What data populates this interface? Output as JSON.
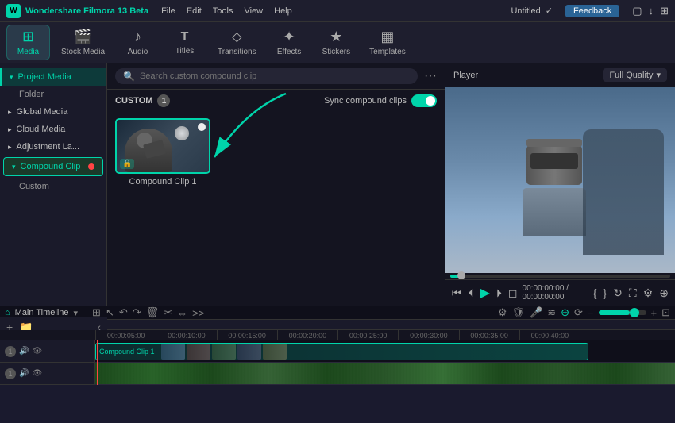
{
  "app": {
    "name": "Wondershare Filmora 13 Beta",
    "title": "Untitled",
    "feedback_label": "Feedback"
  },
  "menu": {
    "items": [
      "File",
      "Edit",
      "Tools",
      "View",
      "Help"
    ]
  },
  "toolbar": {
    "tabs": [
      {
        "id": "media",
        "label": "Media",
        "icon": "⊞",
        "active": true
      },
      {
        "id": "stock-media",
        "label": "Stock Media",
        "icon": "🎬"
      },
      {
        "id": "audio",
        "label": "Audio",
        "icon": "♪"
      },
      {
        "id": "titles",
        "label": "Titles",
        "icon": "T"
      },
      {
        "id": "transitions",
        "label": "Transitions",
        "icon": "⬦"
      },
      {
        "id": "effects",
        "label": "Effects",
        "icon": "✦"
      },
      {
        "id": "stickers",
        "label": "Stickers",
        "icon": "★"
      },
      {
        "id": "templates",
        "label": "Templates",
        "icon": "▦"
      }
    ]
  },
  "sidebar": {
    "items": [
      {
        "id": "project-media",
        "label": "Project Media",
        "arrow": "▾",
        "active": true
      },
      {
        "id": "folder",
        "label": "Folder",
        "sub": true
      },
      {
        "id": "global-media",
        "label": "Global Media",
        "arrow": "▸"
      },
      {
        "id": "cloud-media",
        "label": "Cloud Media",
        "arrow": "▸"
      },
      {
        "id": "adjustment-layer",
        "label": "Adjustment La...",
        "arrow": "▸"
      },
      {
        "id": "compound-clip",
        "label": "Compound Clip",
        "arrow": "▾",
        "selected": true
      },
      {
        "id": "custom",
        "label": "Custom",
        "sub": true
      }
    ]
  },
  "content": {
    "search_placeholder": "Search custom compound clip",
    "section_label": "CUSTOM",
    "section_count": "1",
    "sync_label": "Sync compound clips",
    "clips": [
      {
        "id": "clip1",
        "label": "Compound Clip 1"
      }
    ]
  },
  "preview": {
    "player_label": "Player",
    "quality_label": "Full Quality",
    "time_current": "00:00:00:00",
    "time_total": "00:00:00:00"
  },
  "timeline": {
    "title": "Main Timeline",
    "ruler_marks": [
      "00:00:05:00",
      "00:00:10:00",
      "00:00:15:00",
      "00:00:20:00",
      "00:00:25:00",
      "00:00:30:00",
      "00:00:35:00",
      "00:00:40:00"
    ],
    "tracks": [
      {
        "id": "v1",
        "label": "1",
        "type": "video"
      },
      {
        "id": "a1",
        "label": "1",
        "type": "audio"
      }
    ],
    "clip_label": "Compound Clip 1"
  },
  "colors": {
    "accent": "#00d4aa",
    "bg_dark": "#141420",
    "bg_sidebar": "#1a1a2a",
    "border": "#333333"
  }
}
